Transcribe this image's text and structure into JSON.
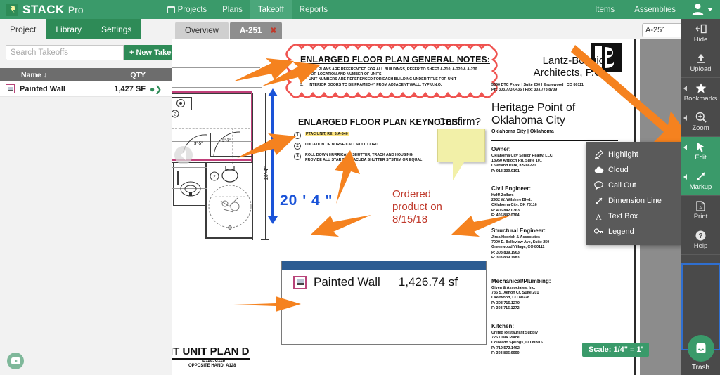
{
  "app": {
    "brand": "STACK",
    "brand_suffix": "Pro",
    "accent_green": "#3a9a6a",
    "dark_green": "#2e8b57",
    "toolbar_gray": "#4a4a4a"
  },
  "topnav": {
    "left_items": [
      {
        "label": "Projects",
        "icon": "calendar-icon",
        "active": false
      },
      {
        "label": "Plans",
        "icon": "",
        "active": false
      },
      {
        "label": "Takeoff",
        "icon": "",
        "active": true
      },
      {
        "label": "Reports",
        "icon": "",
        "active": false
      }
    ],
    "right_items": [
      {
        "label": "Items"
      },
      {
        "label": "Assemblies"
      }
    ],
    "account_icon": "user-avatar-icon"
  },
  "left_panel": {
    "tabs": [
      {
        "label": "Project",
        "active": false
      },
      {
        "label": "Library",
        "active": true
      },
      {
        "label": "Settings",
        "active": true
      }
    ],
    "search": {
      "placeholder": "Search Takeoffs",
      "value": ""
    },
    "new_takeoff_label": "+ New Takeoff",
    "table": {
      "columns": [
        "Name ↓",
        "QTY"
      ],
      "rows": [
        {
          "name": "Painted Wall",
          "qty": "1,427 SF",
          "swatch_color": "#b8447a"
        }
      ]
    },
    "play_button_icon": "play-video-icon"
  },
  "doc_bar": {
    "tabs": [
      {
        "label": "Overview",
        "active": false,
        "closable": false
      },
      {
        "label": "A-251",
        "active": true,
        "closable": true
      }
    ],
    "close_glyph": "✖",
    "page_select": {
      "value": "A-251"
    }
  },
  "right_toolbar": {
    "items": [
      {
        "label": "Hide",
        "icon": "hide-panel-icon",
        "active": false,
        "has_arrow": false
      },
      {
        "label": "Upload",
        "icon": "upload-icon",
        "active": false,
        "has_arrow": false
      },
      {
        "label": "Bookmarks",
        "icon": "star-icon",
        "active": false,
        "has_arrow": true
      },
      {
        "label": "Zoom",
        "icon": "magnifier-plus-icon",
        "active": false,
        "has_arrow": true
      },
      {
        "label": "Edit",
        "icon": "cursor-arrow-icon",
        "active": true,
        "has_arrow": true
      },
      {
        "label": "Markup",
        "icon": "diagonal-arrows-icon",
        "active": true,
        "has_arrow": true
      },
      {
        "label": "Print",
        "icon": "pdf-print-icon",
        "active": false,
        "has_arrow": false
      },
      {
        "label": "Help",
        "icon": "question-circle-icon",
        "active": false,
        "has_arrow": false
      }
    ],
    "trash": {
      "label": "Trash",
      "icon": "trash-can-icon"
    }
  },
  "markup_menu": {
    "items": [
      {
        "label": "Highlight",
        "icon": "highlighter-pen-icon"
      },
      {
        "label": "Cloud",
        "icon": "cloud-icon"
      },
      {
        "label": "Call Out",
        "icon": "speech-bubble-icon"
      },
      {
        "label": "Dimension Line",
        "icon": "dimension-line-icon"
      },
      {
        "label": "Text Box",
        "icon": "letter-a-icon"
      },
      {
        "label": "Legend",
        "icon": "legend-key-icon"
      }
    ]
  },
  "sheet": {
    "general_notes": {
      "title": "ENLARGED FLOOR PLAN GENERAL NOTES:",
      "items": [
        {
          "num": "1.",
          "text": "UNIT PLANS ARE REFERENCED FOR ALL BUILDINGS, REFER TO SHEET A-210, A-220 & A-230 FOR LOCATION AND NUMBER OF UNITS"
        },
        {
          "num": "2.",
          "text": "UNIT NUMBERS ARE REFERENCED FOR EACH BUILDING UNDER TITLE FOR UNIT"
        },
        {
          "num": "3.",
          "text": "INTERIOR DOORS TO BE FRAMED 4\" FROM ADJACENT WALL, TYP U.N.O."
        }
      ]
    },
    "keynotes": {
      "title": "ENLARGED FLOOR PLAN KEYNOTES:",
      "items": [
        {
          "num": "1",
          "text": "PTAC UNIT, RE: 6/A-540",
          "highlighted": true
        },
        {
          "num": "2",
          "text": "LOCATION OF NURSE CALL PULL CORD",
          "highlighted": false
        },
        {
          "num": "3",
          "text": "ROLL DOWN HURRICANE SHUTTER, TRACK AND HOUSING.  PROVIDE ALU STAR BARRACUDA SHUTTER SYSTEM OR EQUAL",
          "highlighted": false
        }
      ]
    },
    "sticky_note": {
      "text": "Confirm?"
    },
    "red_annotation": {
      "lines": [
        "Ordered",
        "product on",
        "8/15/18"
      ],
      "color": "#c0392b"
    },
    "dimension_annotation": {
      "text": "20 ' 4 \"",
      "color": "#1a53d8"
    },
    "vertical_dim_label": "20'-4\"",
    "plan_title": {
      "main": "IT UNIT PLAN D",
      "sub_line1": "B128, C128",
      "sub_line2": "OPPOSITE HAND: A128"
    },
    "title_block": {
      "logo_letter": "B",
      "firm_line1": "Lantz-Boggio",
      "firm_line2": "Architects, P.C.",
      "address": "5650 DTC Pkwy. | Suite 200 | Englewood | CO 80111",
      "phone": "Ph: 303.773.0436 | Fax: 303.773.8709",
      "project_line1": "Heritage Point of",
      "project_line2": "Oklahoma City",
      "project_location": "Oklahoma City | Oklahoma",
      "sections": [
        {
          "heading": "Owner:",
          "body": "Oklahoma City Senior Realty, LLC.\n18950 Antioch Rd, Suite 101\nOverland Park, KS 66221\nP:   913.339.9191"
        },
        {
          "heading": "Civil Engineer:",
          "body": "Halff-Zollars\n2932 W. Wilshire Blvd.\nOklahoma City, OK 73116\nP:   405.842.0363\nF:   405.842.0364"
        },
        {
          "heading": "Structural Engineer:",
          "body": "Jirsa Hedrick & Associates\n7000 E. Belleview Ave, Suite 250\nGreenwood Village, CO 80111\nP:   303.839.1963\nF:   303.839.1983"
        },
        {
          "heading": "Mechanical/Plumbing:",
          "body": "Given & Associates, Inc.\n735 S. Xenon Ct. Suite 201\nLakewood, CO 80228\nP:   303.716.1270\nF:   303.716.1272"
        },
        {
          "heading": "Kitchen:",
          "body": "United Restaurant Supply\n725 Clark Place\nColorado Springs, CO 80915\nP:   719.572.1462\nF:   303.836.6990"
        }
      ]
    },
    "legend": {
      "item_label": "Painted Wall",
      "item_value": "1,426.74  sf",
      "swatch_color": "#b8447a",
      "header_color": "#2c5c92"
    },
    "scale_chip": {
      "text": "Scale: 1/4\" = 1'"
    }
  }
}
